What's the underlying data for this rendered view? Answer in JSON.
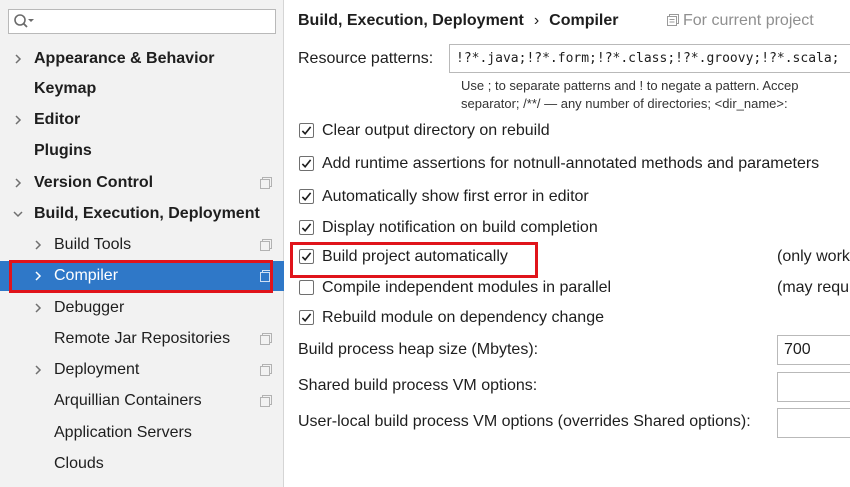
{
  "sidebar": {
    "search": {
      "value": "",
      "placeholder": ""
    },
    "items": [
      {
        "label": "Appearance & Behavior",
        "bold": true,
        "expandable": true,
        "expanded": false,
        "level": 0,
        "project_icon": false
      },
      {
        "label": "Keymap",
        "bold": true,
        "expandable": false,
        "level": 0,
        "project_icon": false
      },
      {
        "label": "Editor",
        "bold": true,
        "expandable": true,
        "expanded": false,
        "level": 0,
        "project_icon": false
      },
      {
        "label": "Plugins",
        "bold": true,
        "expandable": false,
        "level": 0,
        "project_icon": false
      },
      {
        "label": "Version Control",
        "bold": true,
        "expandable": true,
        "expanded": false,
        "level": 0,
        "project_icon": true
      },
      {
        "label": "Build, Execution, Deployment",
        "bold": true,
        "expandable": true,
        "expanded": true,
        "level": 0,
        "project_icon": false
      },
      {
        "label": "Build Tools",
        "bold": false,
        "expandable": true,
        "expanded": false,
        "level": 1,
        "project_icon": true
      },
      {
        "label": "Compiler",
        "bold": false,
        "expandable": true,
        "expanded": false,
        "level": 1,
        "project_icon": true,
        "selected": true
      },
      {
        "label": "Debugger",
        "bold": false,
        "expandable": true,
        "expanded": false,
        "level": 1,
        "project_icon": false
      },
      {
        "label": "Remote Jar Repositories",
        "bold": false,
        "expandable": false,
        "level": 1,
        "project_icon": true
      },
      {
        "label": "Deployment",
        "bold": false,
        "expandable": true,
        "expanded": false,
        "level": 1,
        "project_icon": true
      },
      {
        "label": "Arquillian Containers",
        "bold": false,
        "expandable": false,
        "level": 1,
        "project_icon": true
      },
      {
        "label": "Application Servers",
        "bold": false,
        "expandable": false,
        "level": 1,
        "project_icon": false
      },
      {
        "label": "Clouds",
        "bold": false,
        "expandable": false,
        "level": 1,
        "project_icon": false
      }
    ]
  },
  "breadcrumb": {
    "parent": "Build, Execution, Deployment",
    "separator": "›",
    "current": "Compiler"
  },
  "for_project": "For current project",
  "resource_patterns": {
    "label": "Resource patterns:",
    "value": "!?*.java;!?*.form;!?*.class;!?*.groovy;!?*.scala;",
    "hint_line1": "Use ; to separate patterns and ! to negate a pattern. Accep",
    "hint_line2": "separator; /**/ — any number of directories; <dir_name>:"
  },
  "options": [
    {
      "label": "Clear output directory on rebuild",
      "checked": true
    },
    {
      "label": "Add runtime assertions for notnull-annotated methods and parameters",
      "checked": true
    },
    {
      "label": "Automatically show first error in editor",
      "checked": true
    },
    {
      "label": "Display notification on build completion",
      "checked": true
    },
    {
      "label": "Build project automatically",
      "checked": true,
      "note": "(only work"
    },
    {
      "label": "Compile independent modules in parallel",
      "checked": false,
      "note": "(may requ"
    },
    {
      "label": "Rebuild module on dependency change",
      "checked": true
    }
  ],
  "fields": {
    "heap_label": "Build process heap size (Mbytes):",
    "heap_value": "700",
    "shared_label": "Shared build process VM options:",
    "shared_value": "",
    "user_label": "User-local build process VM options (overrides Shared options):",
    "user_value": ""
  },
  "colors": {
    "selection": "#2f78c8",
    "highlight_outline": "#e0141b",
    "sidebar_bg": "#f2f2f2"
  }
}
